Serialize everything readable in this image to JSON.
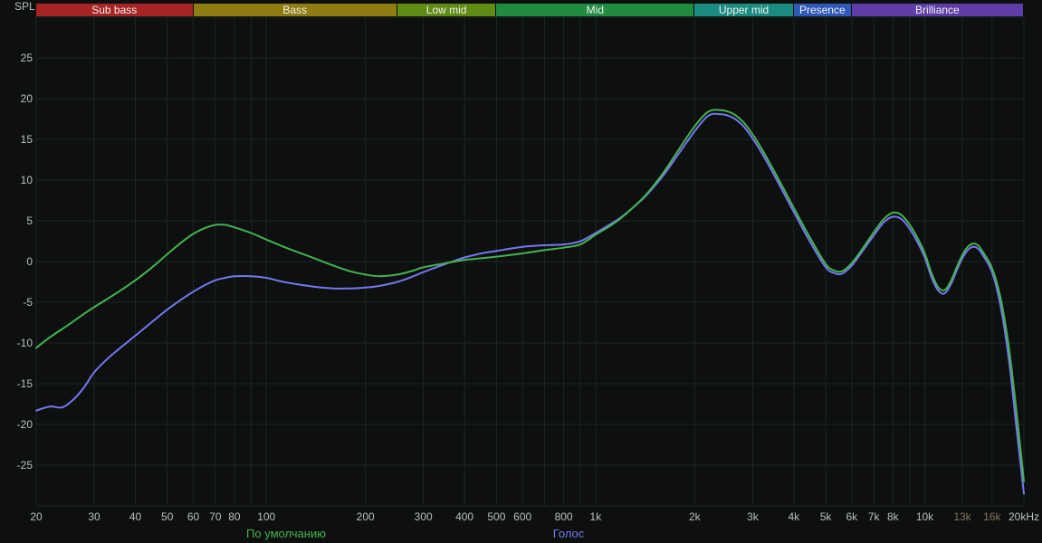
{
  "colors": {
    "background": "#0d100f",
    "grid": "#1d2525",
    "tick_text": "#b9c0c1",
    "tick_text_dim": "#85755a",
    "band_text": "#f2f2f2"
  },
  "chart_data": {
    "type": "line",
    "title": "",
    "ylabel": "SPL",
    "xlabel": "",
    "x_scale": "log",
    "x_range": [
      20,
      20000
    ],
    "y_range": [
      -30,
      30
    ],
    "grid": true,
    "legend_position": "bottom",
    "y_ticks": [
      25,
      20,
      15,
      10,
      5,
      0,
      -5,
      -10,
      -15,
      -20,
      -25
    ],
    "x_ticks": [
      {
        "f": 20,
        "label": "20"
      },
      {
        "f": 30,
        "label": "30"
      },
      {
        "f": 40,
        "label": "40"
      },
      {
        "f": 50,
        "label": "50"
      },
      {
        "f": 60,
        "label": "60"
      },
      {
        "f": 70,
        "label": "70"
      },
      {
        "f": 80,
        "label": "80"
      },
      {
        "f": 100,
        "label": "100"
      },
      {
        "f": 200,
        "label": "200"
      },
      {
        "f": 300,
        "label": "300"
      },
      {
        "f": 400,
        "label": "400"
      },
      {
        "f": 500,
        "label": "500"
      },
      {
        "f": 600,
        "label": "600"
      },
      {
        "f": 800,
        "label": "800"
      },
      {
        "f": 1000,
        "label": "1k"
      },
      {
        "f": 2000,
        "label": "2k"
      },
      {
        "f": 3000,
        "label": "3k"
      },
      {
        "f": 4000,
        "label": "4k"
      },
      {
        "f": 5000,
        "label": "5k"
      },
      {
        "f": 6000,
        "label": "6k"
      },
      {
        "f": 7000,
        "label": "7k"
      },
      {
        "f": 8000,
        "label": "8k"
      },
      {
        "f": 10000,
        "label": "10k"
      },
      {
        "f": 13000,
        "label": "13k",
        "dim": true
      },
      {
        "f": 16000,
        "label": "16k",
        "dim": true
      },
      {
        "f": 20000,
        "label": "20kHz"
      }
    ],
    "x_gridlines": [
      20,
      30,
      40,
      50,
      60,
      70,
      80,
      90,
      100,
      200,
      300,
      400,
      500,
      600,
      700,
      800,
      900,
      1000,
      2000,
      3000,
      4000,
      5000,
      6000,
      7000,
      8000,
      9000,
      10000,
      13000,
      16000,
      20000
    ],
    "bands": [
      {
        "label": "Sub bass",
        "from": 20,
        "to": 60,
        "color": "#a82424"
      },
      {
        "label": "Bass",
        "from": 60,
        "to": 250,
        "color": "#8f7d12"
      },
      {
        "label": "Low mid",
        "from": 250,
        "to": 500,
        "color": "#5e8c14"
      },
      {
        "label": "Mid",
        "from": 500,
        "to": 2000,
        "color": "#1f8c40"
      },
      {
        "label": "Upper mid",
        "from": 2000,
        "to": 4000,
        "color": "#1a8c82"
      },
      {
        "label": "Presence",
        "from": 4000,
        "to": 6000,
        "color": "#2f58b8"
      },
      {
        "label": "Brilliance",
        "from": 6000,
        "to": 20000,
        "color": "#5e3da8"
      }
    ],
    "series": [
      {
        "name": "По умолчанию",
        "key": "default",
        "color": "#45b24f",
        "points": [
          [
            20,
            -10.6
          ],
          [
            22,
            -9.3
          ],
          [
            25,
            -7.8
          ],
          [
            28,
            -6.4
          ],
          [
            30,
            -5.6
          ],
          [
            35,
            -3.9
          ],
          [
            40,
            -2.3
          ],
          [
            45,
            -0.7
          ],
          [
            50,
            0.9
          ],
          [
            55,
            2.3
          ],
          [
            60,
            3.4
          ],
          [
            65,
            4.1
          ],
          [
            70,
            4.5
          ],
          [
            75,
            4.5
          ],
          [
            80,
            4.2
          ],
          [
            90,
            3.5
          ],
          [
            100,
            2.7
          ],
          [
            110,
            2.0
          ],
          [
            120,
            1.4
          ],
          [
            140,
            0.4
          ],
          [
            160,
            -0.5
          ],
          [
            180,
            -1.2
          ],
          [
            200,
            -1.6
          ],
          [
            220,
            -1.8
          ],
          [
            250,
            -1.6
          ],
          [
            280,
            -1.1
          ],
          [
            300,
            -0.7
          ],
          [
            350,
            -0.2
          ],
          [
            400,
            0.2
          ],
          [
            450,
            0.4
          ],
          [
            500,
            0.6
          ],
          [
            600,
            1.0
          ],
          [
            700,
            1.4
          ],
          [
            800,
            1.7
          ],
          [
            900,
            2.1
          ],
          [
            1000,
            3.3
          ],
          [
            1100,
            4.3
          ],
          [
            1200,
            5.4
          ],
          [
            1400,
            7.9
          ],
          [
            1600,
            10.8
          ],
          [
            1800,
            13.9
          ],
          [
            2000,
            16.6
          ],
          [
            2200,
            18.4
          ],
          [
            2400,
            18.6
          ],
          [
            2600,
            18.2
          ],
          [
            2800,
            17.2
          ],
          [
            3000,
            15.6
          ],
          [
            3200,
            13.8
          ],
          [
            3500,
            11.0
          ],
          [
            4000,
            6.6
          ],
          [
            4500,
            2.8
          ],
          [
            5000,
            -0.3
          ],
          [
            5300,
            -1.1
          ],
          [
            5600,
            -1.2
          ],
          [
            6000,
            -0.2
          ],
          [
            6500,
            1.7
          ],
          [
            7000,
            3.6
          ],
          [
            7500,
            5.2
          ],
          [
            8000,
            6.0
          ],
          [
            8500,
            5.7
          ],
          [
            9000,
            4.5
          ],
          [
            9500,
            2.9
          ],
          [
            10000,
            1.0
          ],
          [
            10500,
            -1.5
          ],
          [
            11000,
            -3.2
          ],
          [
            11500,
            -3.5
          ],
          [
            12000,
            -2.4
          ],
          [
            12500,
            -0.7
          ],
          [
            13000,
            0.8
          ],
          [
            13500,
            1.8
          ],
          [
            14000,
            2.2
          ],
          [
            14500,
            2.0
          ],
          [
            15000,
            1.2
          ],
          [
            16000,
            -0.8
          ],
          [
            17000,
            -4.5
          ],
          [
            18000,
            -10.5
          ],
          [
            19000,
            -18.5
          ],
          [
            20000,
            -27.0
          ]
        ]
      },
      {
        "name": "Голос",
        "key": "voice",
        "color": "#7577ee",
        "points": [
          [
            20,
            -18.3
          ],
          [
            22,
            -17.8
          ],
          [
            24,
            -17.9
          ],
          [
            26,
            -16.9
          ],
          [
            28,
            -15.4
          ],
          [
            30,
            -13.6
          ],
          [
            33,
            -11.9
          ],
          [
            36,
            -10.6
          ],
          [
            40,
            -9.1
          ],
          [
            45,
            -7.4
          ],
          [
            50,
            -5.9
          ],
          [
            55,
            -4.7
          ],
          [
            60,
            -3.7
          ],
          [
            65,
            -2.9
          ],
          [
            70,
            -2.3
          ],
          [
            75,
            -2.0
          ],
          [
            80,
            -1.8
          ],
          [
            90,
            -1.8
          ],
          [
            100,
            -2.0
          ],
          [
            110,
            -2.4
          ],
          [
            120,
            -2.7
          ],
          [
            140,
            -3.1
          ],
          [
            160,
            -3.3
          ],
          [
            180,
            -3.3
          ],
          [
            200,
            -3.2
          ],
          [
            220,
            -3.0
          ],
          [
            250,
            -2.5
          ],
          [
            280,
            -1.8
          ],
          [
            300,
            -1.3
          ],
          [
            350,
            -0.3
          ],
          [
            400,
            0.5
          ],
          [
            450,
            1.0
          ],
          [
            500,
            1.3
          ],
          [
            600,
            1.8
          ],
          [
            700,
            2.0
          ],
          [
            800,
            2.1
          ],
          [
            900,
            2.5
          ],
          [
            1000,
            3.5
          ],
          [
            1100,
            4.5
          ],
          [
            1200,
            5.5
          ],
          [
            1400,
            7.8
          ],
          [
            1600,
            10.5
          ],
          [
            1800,
            13.4
          ],
          [
            2000,
            16.0
          ],
          [
            2200,
            17.9
          ],
          [
            2400,
            18.1
          ],
          [
            2600,
            17.7
          ],
          [
            2800,
            16.7
          ],
          [
            3000,
            15.1
          ],
          [
            3200,
            13.3
          ],
          [
            3500,
            10.5
          ],
          [
            4000,
            6.1
          ],
          [
            4500,
            2.3
          ],
          [
            5000,
            -0.7
          ],
          [
            5300,
            -1.4
          ],
          [
            5600,
            -1.5
          ],
          [
            6000,
            -0.5
          ],
          [
            6500,
            1.4
          ],
          [
            7000,
            3.2
          ],
          [
            7500,
            4.8
          ],
          [
            8000,
            5.5
          ],
          [
            8500,
            5.2
          ],
          [
            9000,
            4.0
          ],
          [
            9500,
            2.4
          ],
          [
            10000,
            0.5
          ],
          [
            10500,
            -2.0
          ],
          [
            11000,
            -3.6
          ],
          [
            11500,
            -3.9
          ],
          [
            12000,
            -2.8
          ],
          [
            12500,
            -1.1
          ],
          [
            13000,
            0.4
          ],
          [
            13500,
            1.4
          ],
          [
            14000,
            1.8
          ],
          [
            14500,
            1.6
          ],
          [
            15000,
            0.8
          ],
          [
            16000,
            -1.3
          ],
          [
            17000,
            -5.5
          ],
          [
            18000,
            -12.0
          ],
          [
            19000,
            -20.5
          ],
          [
            20000,
            -28.5
          ]
        ]
      }
    ]
  }
}
